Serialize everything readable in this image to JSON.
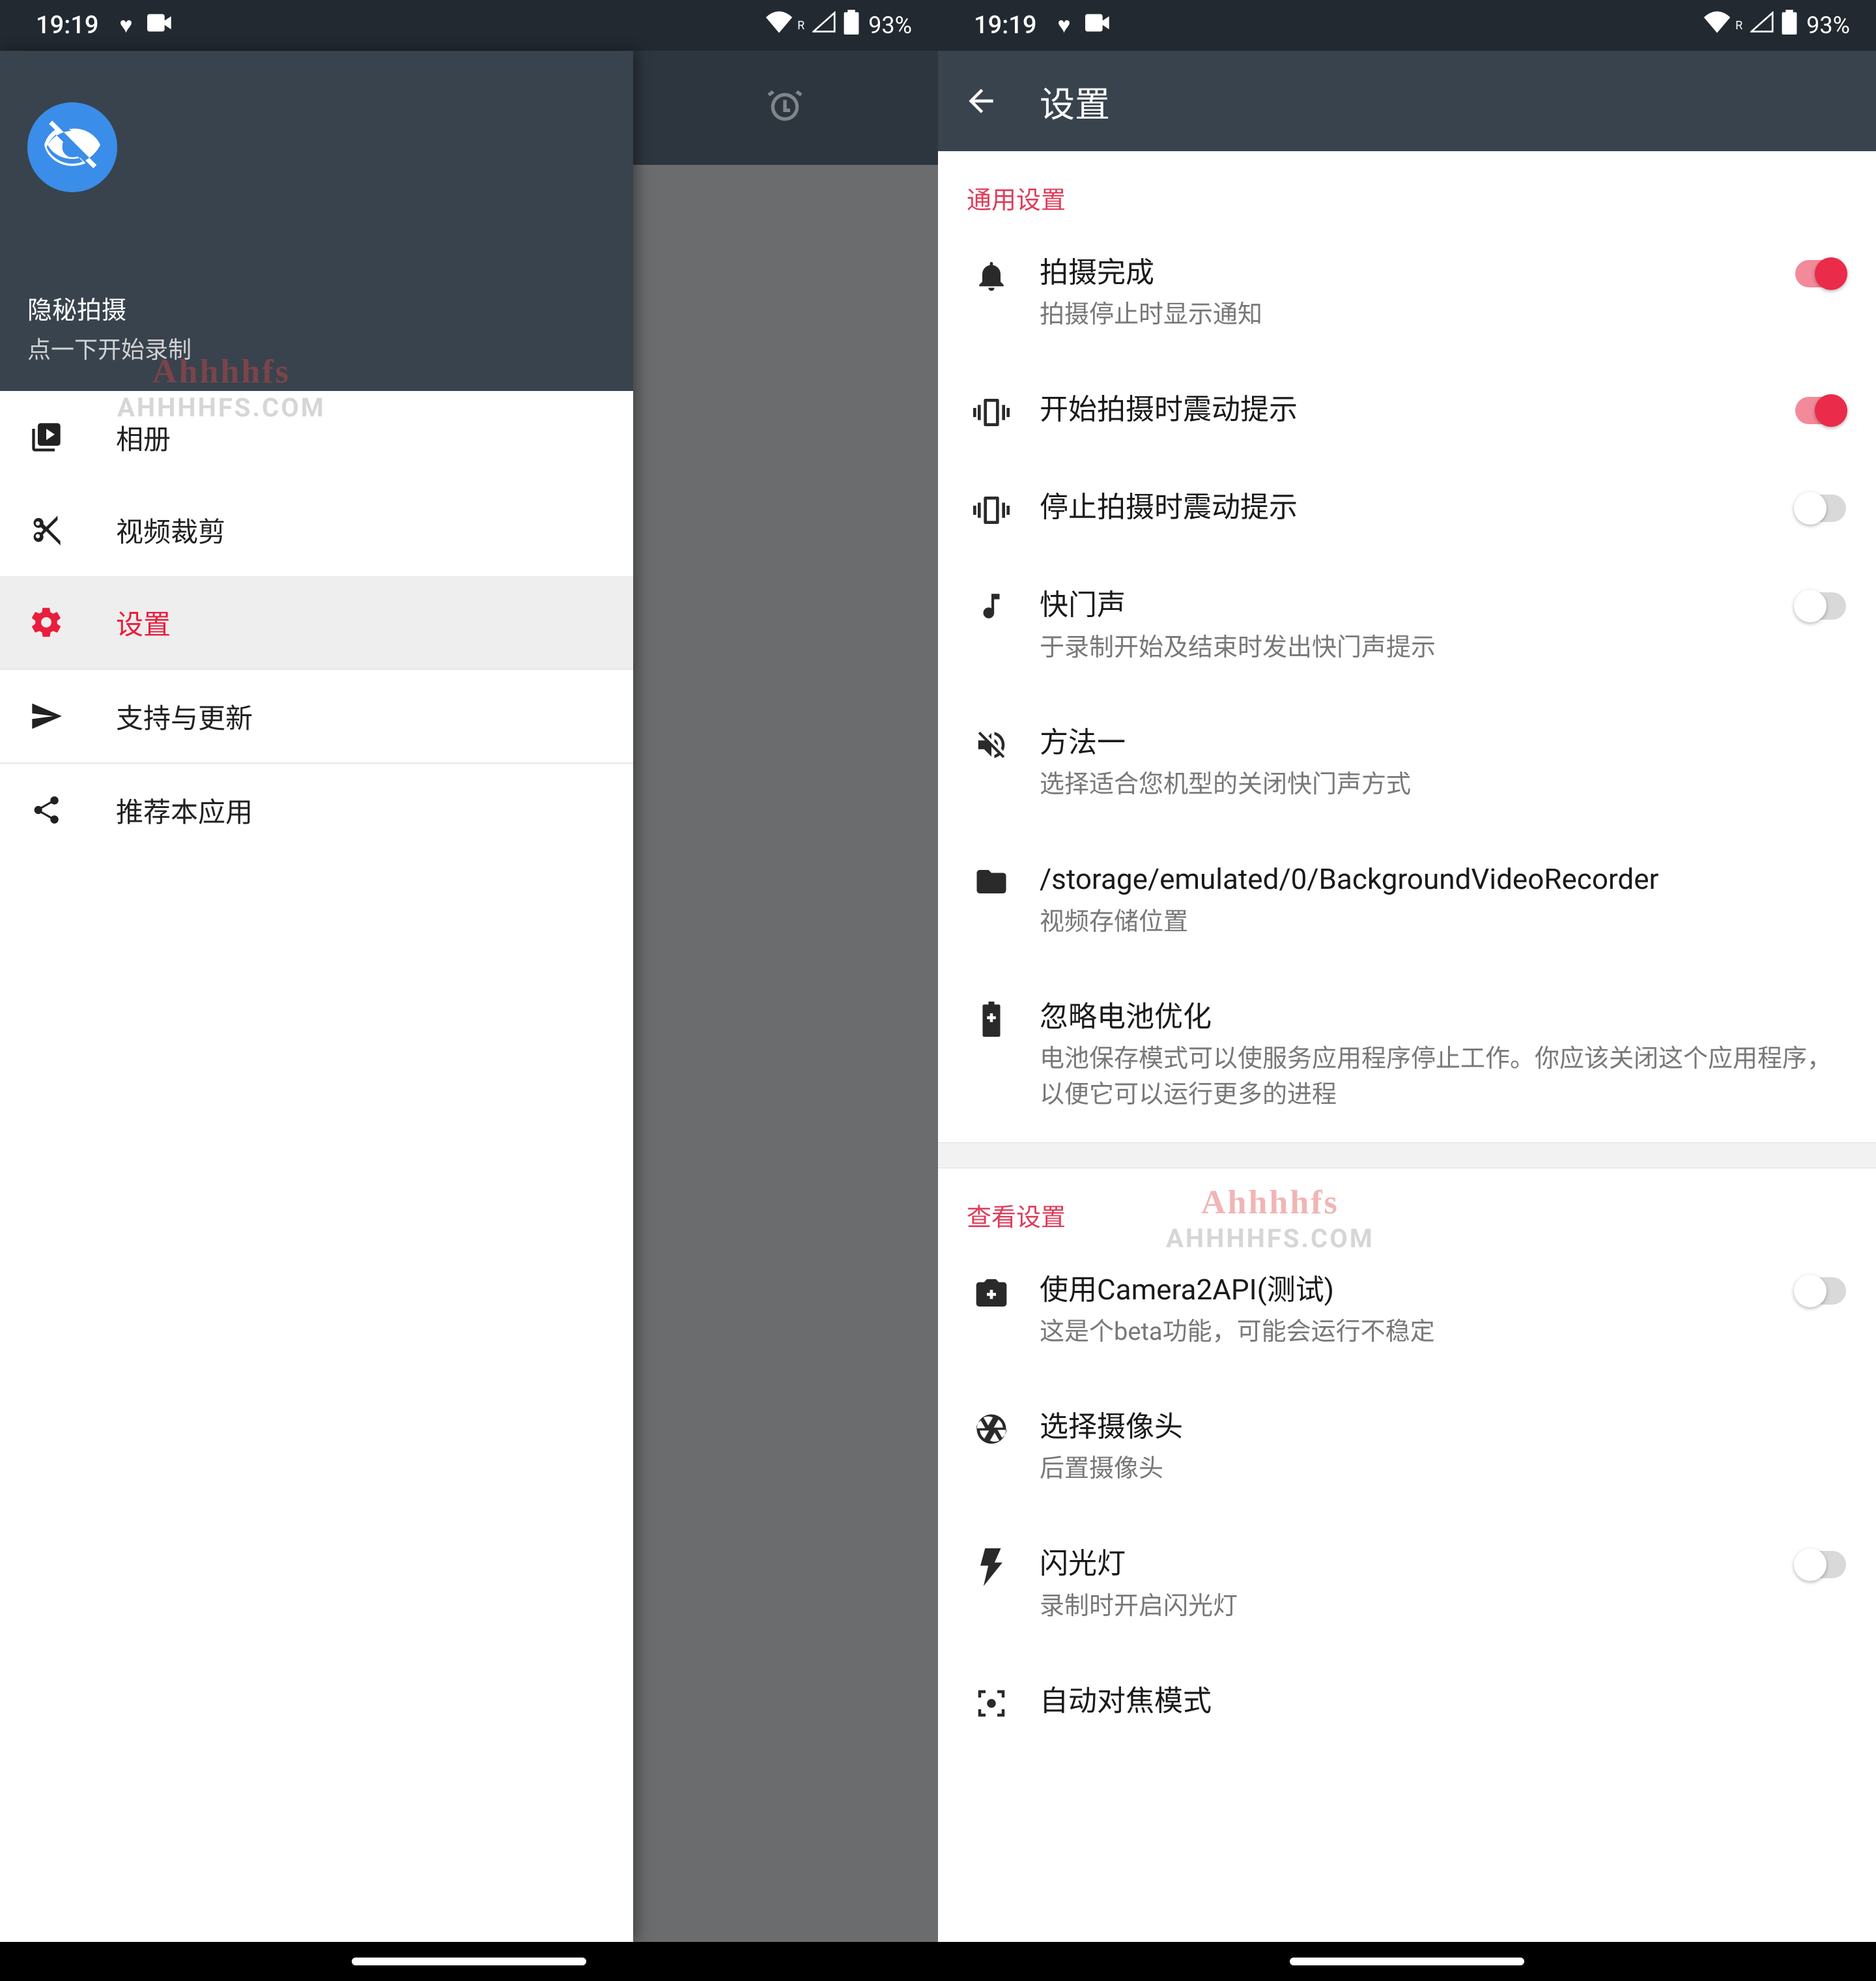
{
  "status": {
    "time": "19:19",
    "battery_pct": "93%"
  },
  "left": {
    "drawer": {
      "title": "隐秘拍摄",
      "subtitle": "点一下开始录制",
      "items": [
        {
          "label": "相册"
        },
        {
          "label": "视频裁剪"
        },
        {
          "label": "设置"
        },
        {
          "label": "支持与更新"
        },
        {
          "label": "推荐本应用"
        }
      ]
    }
  },
  "right": {
    "appbar_title": "设置",
    "sections": {
      "general_header": "通用设置",
      "view_header": "查看设置"
    },
    "rows": {
      "done": {
        "title": "拍摄完成",
        "sub": "拍摄停止时显示通知"
      },
      "vibe_start": {
        "title": "开始拍摄时震动提示"
      },
      "vibe_stop": {
        "title": "停止拍摄时震动提示"
      },
      "shutter": {
        "title": "快门声",
        "sub": "于录制开始及结束时发出快门声提示"
      },
      "method": {
        "title": "方法一",
        "sub": "选择适合您机型的关闭快门声方式"
      },
      "storage": {
        "title": "/storage/emulated/0/BackgroundVideoRecorder",
        "sub": "视频存储位置"
      },
      "battery": {
        "title": "忽略电池优化",
        "sub": "电池保存模式可以使服务应用程序停止工作。你应该关闭这个应用程序，以便它可以运行更多的进程"
      },
      "camera2": {
        "title": "使用Camera2API(测试)",
        "sub": "这是个beta功能，可能会运行不稳定"
      },
      "choose_cam": {
        "title": "选择摄像头",
        "sub": "后置摄像头"
      },
      "flash": {
        "title": "闪光灯",
        "sub": "录制时开启闪光灯"
      },
      "autofocus": {
        "title": "自动对焦模式",
        "sub": ""
      }
    }
  },
  "watermark": {
    "top": "Ahhhhfs",
    "bottom": "AHHHHFS.COM"
  }
}
